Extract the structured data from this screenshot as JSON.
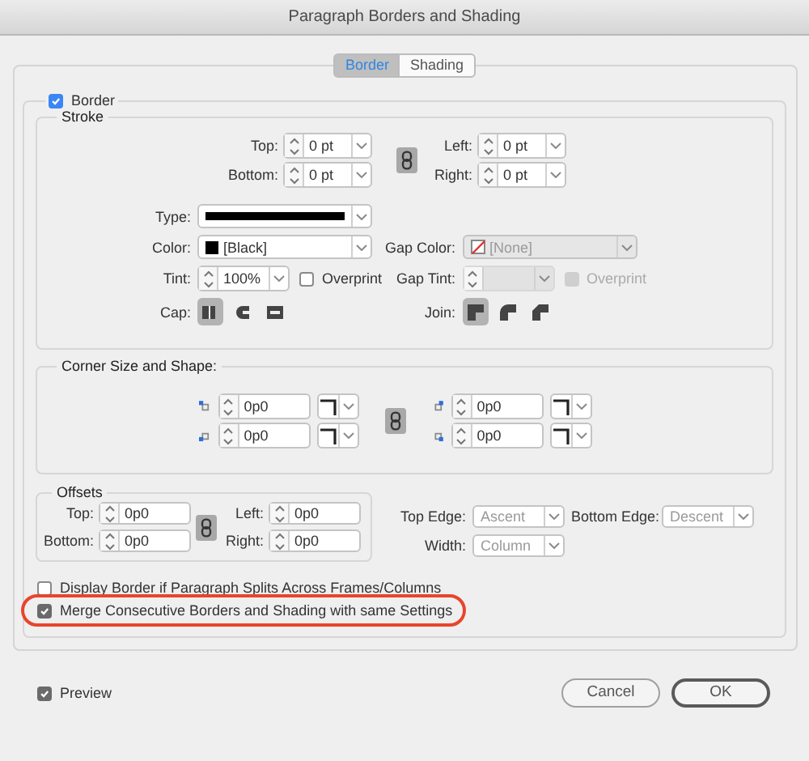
{
  "window": {
    "title": "Paragraph Borders and Shading"
  },
  "tabs": [
    {
      "label": "Border",
      "selected": true
    },
    {
      "label": "Shading",
      "selected": false
    }
  ],
  "border": {
    "label": "Border",
    "checked": true
  },
  "stroke": {
    "title": "Stroke",
    "sides": [
      {
        "label": "Top:",
        "value": "0 pt"
      },
      {
        "label": "Left:",
        "value": "0 pt"
      },
      {
        "label": "Bottom:",
        "value": "0 pt"
      },
      {
        "label": "Right:",
        "value": "0 pt"
      }
    ],
    "type": {
      "label": "Type:"
    },
    "color": {
      "label": "Color:",
      "value": "[Black]"
    },
    "gap_color": {
      "label": "Gap Color:",
      "value": "[None]",
      "disabled": true
    },
    "tint": {
      "label": "Tint:",
      "value": "100%"
    },
    "overprint": {
      "label": "Overprint",
      "checked": false,
      "disabled": false
    },
    "gap_tint": {
      "label": "Gap Tint:",
      "disabled": true
    },
    "gap_overprint": {
      "label": "Overprint",
      "checked": false,
      "disabled": true
    },
    "cap": {
      "label": "Cap:",
      "options": [
        {
          "selected": true
        },
        {
          "selected": false
        },
        {
          "selected": false
        }
      ]
    },
    "join": {
      "label": "Join:",
      "options": [
        {
          "selected": true
        },
        {
          "selected": false
        },
        {
          "selected": false
        }
      ]
    }
  },
  "corners": {
    "title": "Corner Size and Shape:",
    "items": [
      {
        "value": "0p0"
      },
      {
        "value": "0p0"
      },
      {
        "value": "0p0"
      },
      {
        "value": "0p0"
      }
    ]
  },
  "offsets": {
    "title": "Offsets",
    "fields": [
      {
        "label": "Top:",
        "value": "0p0"
      },
      {
        "label": "Left:",
        "value": "0p0"
      },
      {
        "label": "Bottom:",
        "value": "0p0"
      },
      {
        "label": "Right:",
        "value": "0p0"
      }
    ],
    "top_edge": {
      "label": "Top Edge:",
      "value": "Ascent",
      "disabled": true
    },
    "bottom_edge": {
      "label": "Bottom Edge:",
      "value": "Descent",
      "disabled": true
    },
    "width": {
      "label": "Width:",
      "value": "Column",
      "disabled": true
    }
  },
  "options": [
    {
      "label": "Display Border if Paragraph Splits Across Frames/Columns",
      "checked": false,
      "highlighted": false
    },
    {
      "label": "Merge Consecutive Borders and Shading with same Settings",
      "checked": true,
      "highlighted": true
    }
  ],
  "preview": {
    "label": "Preview",
    "checked": true
  },
  "buttons": [
    {
      "label": "Cancel",
      "default": false
    },
    {
      "label": "OK",
      "default": true
    }
  ]
}
